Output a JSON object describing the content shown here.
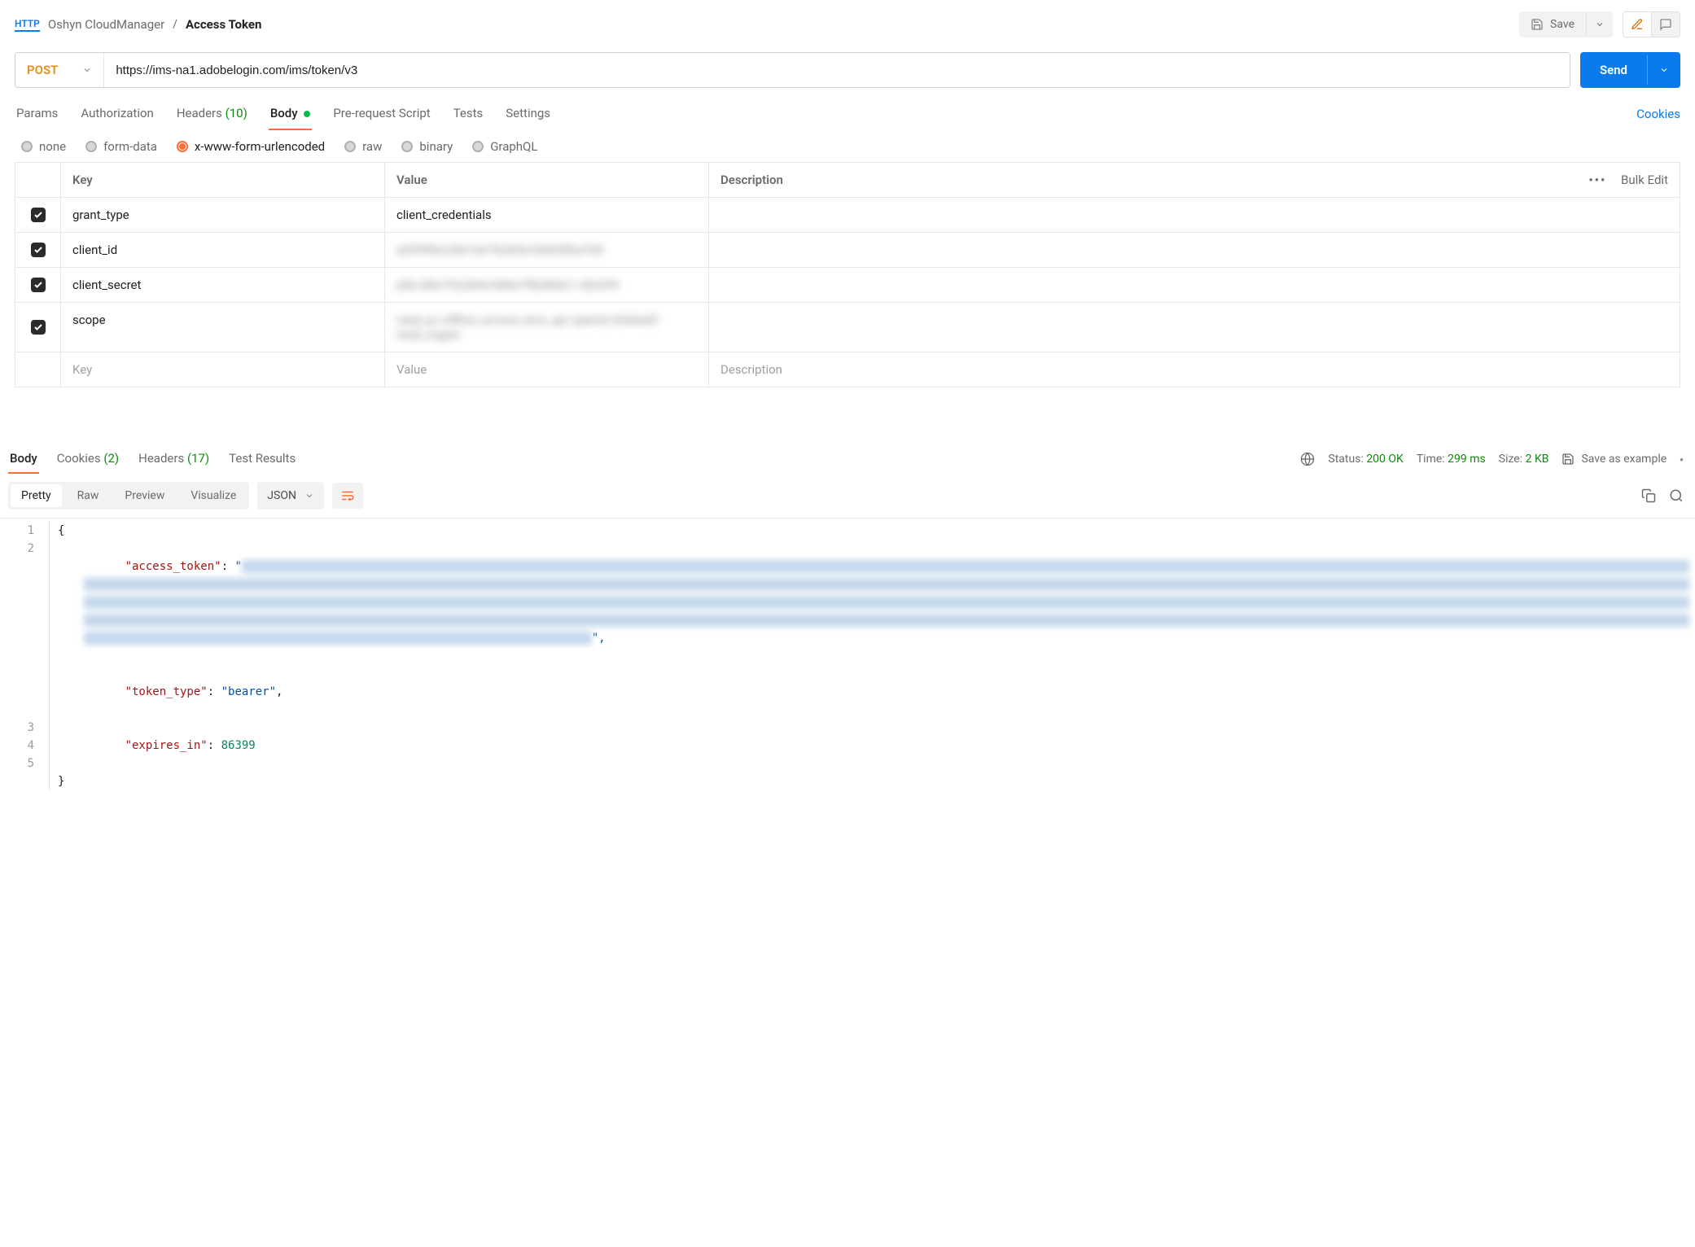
{
  "breadcrumb": {
    "icon": "HTTP",
    "parent": "Oshyn CloudManager",
    "separator": "/",
    "current": "Access Token"
  },
  "header_actions": {
    "save_label": "Save"
  },
  "request": {
    "method": "POST",
    "url": "https://ims-na1.adobelogin.com/ims/token/v3",
    "send_label": "Send"
  },
  "req_tabs": {
    "params": "Params",
    "authorization": "Authorization",
    "headers_label": "Headers",
    "headers_count": "(10)",
    "body": "Body",
    "prerequest": "Pre-request Script",
    "tests": "Tests",
    "settings": "Settings",
    "cookies": "Cookies"
  },
  "body_types": {
    "none": "none",
    "formdata": "form-data",
    "urlencoded": "x-www-form-urlencoded",
    "raw": "raw",
    "binary": "binary",
    "graphql": "GraphQL"
  },
  "params_table": {
    "headers": {
      "key": "Key",
      "value": "Value",
      "description": "Description",
      "bulk_edit": "Bulk Edit"
    },
    "rows": [
      {
        "key": "grant_type",
        "value": "client_credentials",
        "blurred": false
      },
      {
        "key": "client_id",
        "value": "a0f3f9b2c8d14e7fa2b9c3d4e5f6a7b8",
        "blurred": true
      },
      {
        "key": "client_secret",
        "value": "p8s-d0e1f2a3b4c5d6e7f8a9b0c1-d2e3f4",
        "blurred": true
      },
      {
        "key": "scope",
        "value": "read_pc offline_access ams_api openid AdobeID read_organi",
        "blurred": true
      }
    ],
    "placeholder": {
      "key": "Key",
      "value": "Value",
      "description": "Description"
    }
  },
  "response": {
    "tabs": {
      "body": "Body",
      "cookies_label": "Cookies",
      "cookies_count": "(2)",
      "headers_label": "Headers",
      "headers_count": "(17)",
      "test_results": "Test Results"
    },
    "meta": {
      "status_label": "Status:",
      "status_value": "200 OK",
      "time_label": "Time:",
      "time_value": "299 ms",
      "size_label": "Size:",
      "size_value": "2 KB",
      "save_example": "Save as example"
    },
    "modes": {
      "pretty": "Pretty",
      "raw": "Raw",
      "preview": "Preview",
      "visualize": "Visualize",
      "format": "JSON"
    },
    "json": {
      "line1": "{",
      "line2_key": "\"access_token\"",
      "line2_sep": ": ",
      "line2_quote": "\"",
      "token_blur": "eyJhbGciOiJSUzI1NiIsIng1dSI6Imltc19uYTEta2V5LWF0LTEuY2VyIiwia2lkIjoiaW1zX25hMS1rZXktYXQtMSIsIml0dCI6ImF0In0 eyJpZCI6IjE2OTg3NjU0MzIxMDEyMzQ1Njc4OTAiLCJ0eXBlIjoiYWNjZXNzX3Rva2VuIiwiY2xpZW50X2lkIjoiYTBmM2Y5YjJjOGQxNGU3ZmEyYjljM2Q0ZTVmNmE3YjgiLCJ1c2VyX2lkIjoiMTIzNDU2Nzg5MEFCQ0RFRkBBZG9iZU9yZyIsInN0YXRlIjoie1wic2Vzc2lvblwiOlwiaHR0cHM6Ly9pbXMtbmExLmFkb2JlbG9naW4uY29tL2ltcy9zZXNzaW9uL3YxLzEyMzQ1Njc4OTBhYmNkZWYxMjM0NTY3ODkwYWJjZGVmXCJ9IiwiYXMiOiJpbXMtbmExIiwiYWFfaWQiOiIxMjM0NTY3ODkwQUJDREVGQEFkb2JlT3JnIiwiY3RwIjowLCJmZyI6IlhZWldBQkNERUZHSElKS0wiLCJzaWQiOiIxNjk4NzY1NDMyMTAxXzEyMzQ1Njc4LTkwYWItY2RlZi0xMjM0LTU2Nzg5MGFiY2RlZl9uYTEiLCJtb2kiOiIxMjM0NTY3OCIsInBiYSI6IixNZWRTZWNOb0VWIiwiZXhwaXJlc19pbiI6Ijg2NDAwMDAwIiwic2NvcGUiOiJyZWFkX3BjLG9mZmxpbmVfYWNjZXNzLGFtc19hcGksb3BlbmlkLEFkb2JlSUQscmVhZF9vcmdhbml6YXRpb25zIiwiY3JlYXRlZF9hdCI6IjE2OTg3NjU0MzIxMDEifQ ABCDEFGHIJKLMNOPQRSTUVWXYZabcdefghijklmnopqrstuvwxyz0123456789ABCDEFGHIJKLMNOPQRSTUVWXYZabcdefghijklmnopqrstuvwxyz0123456789ABCDEFGHIJKL",
      "line2_end": "\",",
      "line3_key": "\"token_type\"",
      "line3_val": "\"bearer\"",
      "line4_key": "\"expires_in\"",
      "line4_val": "86399",
      "line5": "}"
    }
  }
}
